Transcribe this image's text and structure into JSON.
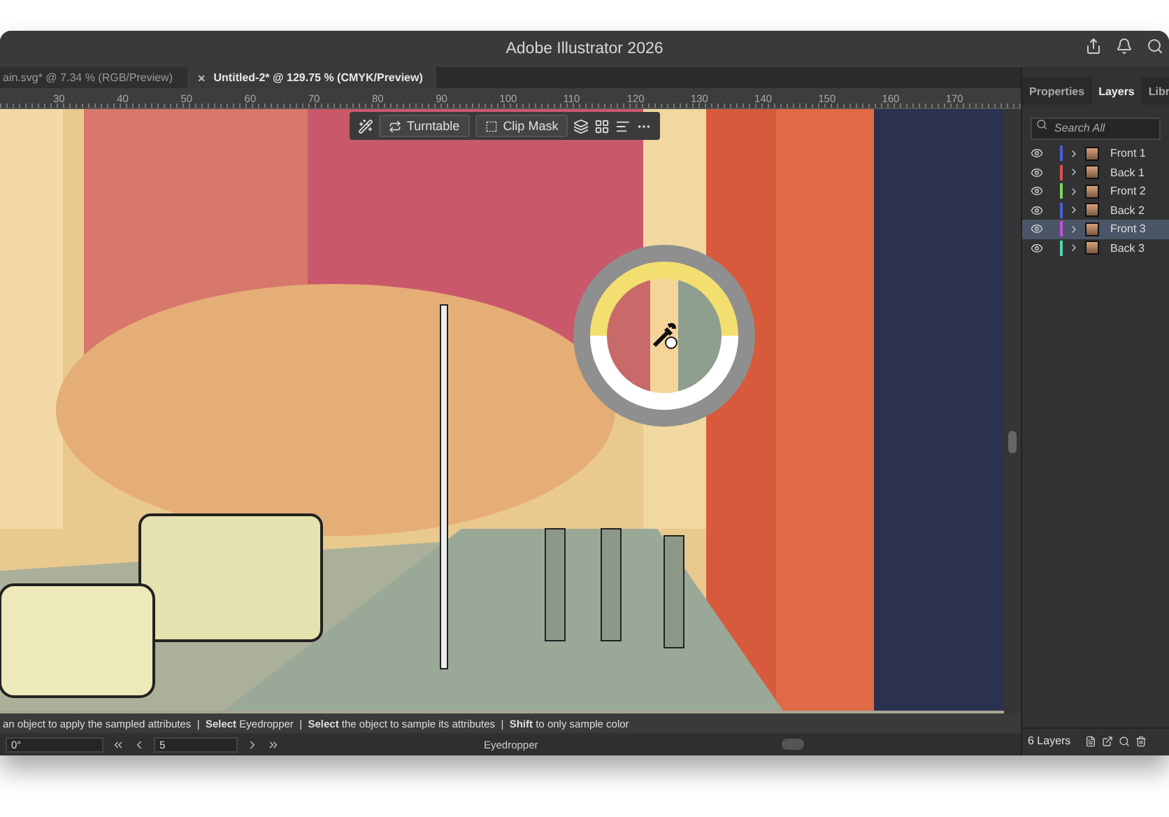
{
  "window": {
    "title": "Adobe Illustrator 2026"
  },
  "tabs": [
    {
      "label": "ain.svg* @ 7.34 % (RGB/Preview)",
      "selected": false
    },
    {
      "label": "Untitled-2* @ 129.75 % (CMYK/Preview)",
      "selected": true,
      "close": "×"
    }
  ],
  "ruler": [
    "30",
    "40",
    "50",
    "60",
    "70",
    "80",
    "90",
    "100",
    "110",
    "120",
    "130",
    "140",
    "150",
    "160",
    "170"
  ],
  "context_toolbar": {
    "buttons": [
      "Turntable",
      "Clip Mask"
    ]
  },
  "panel": {
    "tabs": [
      {
        "label": "Properties",
        "selected": false
      },
      {
        "label": "Layers",
        "selected": true
      },
      {
        "label": "Libr",
        "selected": false
      }
    ],
    "search": {
      "placeholder": "Search All"
    },
    "layers": [
      {
        "name": "Front 1",
        "color": "#4a5fd6",
        "visible": true,
        "selected": false
      },
      {
        "name": "Back 1",
        "color": "#d9534f",
        "visible": true,
        "selected": false
      },
      {
        "name": "Front 2",
        "color": "#7fd45a",
        "visible": true,
        "selected": false
      },
      {
        "name": "Back 2",
        "color": "#4a5fd6",
        "visible": true,
        "selected": false
      },
      {
        "name": "Front 3",
        "color": "#c052d6",
        "visible": true,
        "selected": true
      },
      {
        "name": "Back 3",
        "color": "#4fd6b4",
        "visible": true,
        "selected": false
      }
    ],
    "count": "6 Layers"
  },
  "hint": "an object to apply the sampled attributes  |  **Select** Eyedropper  |  **Select** the object to sample its attributes  |  **Shift** to only sample color",
  "bottom_bar": {
    "rotation": "0°",
    "artboard": "5",
    "tool": "Eyedropper"
  }
}
